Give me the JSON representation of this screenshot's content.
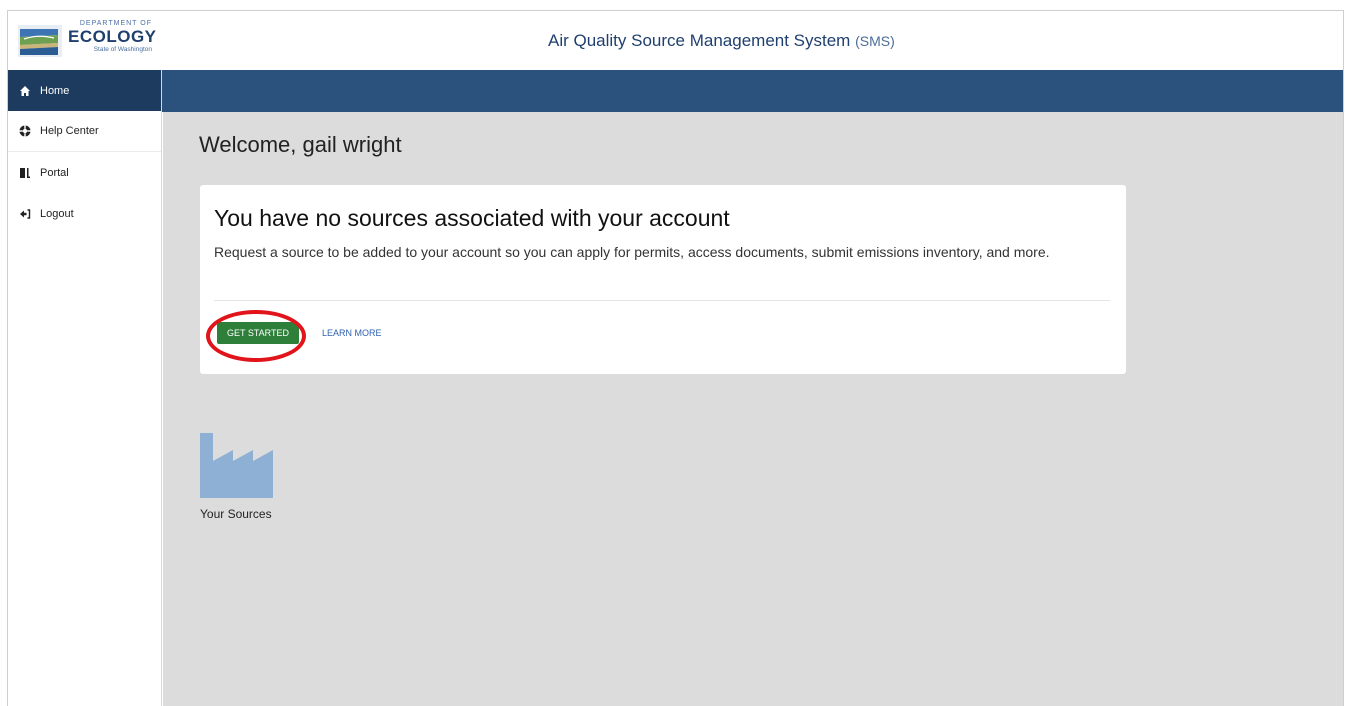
{
  "header": {
    "logo": {
      "top_line": "DEPARTMENT OF",
      "main": "ECOLOGY",
      "sub": "State of Washington"
    },
    "app_title": "Air Quality Source Management System",
    "app_abbr": "(SMS)"
  },
  "sidebar": {
    "items": [
      {
        "label": "Home",
        "icon": "home-icon",
        "active": true
      },
      {
        "label": "Help Center",
        "icon": "help-icon"
      },
      {
        "label": "Portal",
        "icon": "portal-icon"
      },
      {
        "label": "Logout",
        "icon": "logout-icon"
      }
    ]
  },
  "main": {
    "welcome": "Welcome, gail wright",
    "card": {
      "title": "You have no sources associated with your account",
      "body": "Request a source to be added to your account so you can apply for permits, access documents, submit emissions inventory, and more.",
      "primary_button": "GET STARTED",
      "link": "LEARN MORE"
    },
    "tile": {
      "label": "Your Sources",
      "icon": "factory-icon"
    }
  },
  "colors": {
    "navbar": "#2b527c",
    "sidebar_active": "#1d3b5f",
    "button_green": "#2d7f3a",
    "highlight_red": "#e0141a",
    "tile_icon": "#8db0d4",
    "main_bg": "#dcdcdc"
  }
}
